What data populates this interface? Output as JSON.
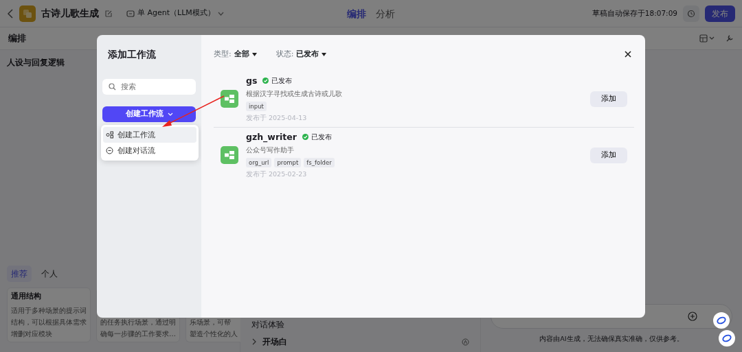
{
  "header": {
    "app_title": "古诗儿歌生成",
    "mode": "单 Agent（LLM模式）",
    "tabs": [
      {
        "label": "编排",
        "selected": true
      },
      {
        "label": "分析",
        "selected": false
      }
    ],
    "save_status": "草稿自动保存于18:07:09",
    "publish": "发布"
  },
  "left_panel": {
    "title": "编排",
    "section": "人设与回复逻辑",
    "template_tabs": [
      {
        "label": "推荐",
        "selected": true
      },
      {
        "label": "个人",
        "selected": false
      }
    ],
    "templates": [
      {
        "title": "通用结构",
        "lines": [
          "适用于多种场景的提示词",
          "结构，可以根据具体需求",
          "增删对应模块"
        ]
      },
      {
        "lines": [
          "的任务执行场景，通过明",
          "确每一步骤的工作要求…"
        ]
      },
      {
        "lines": [
          "乐场景，可帮",
          "塑造个性化的人"
        ]
      }
    ]
  },
  "middle_panel": {
    "section": "对话体验",
    "items": [
      {
        "label": "开场白",
        "expanded": false
      }
    ]
  },
  "chat": {
    "disclaimer": "内容由AI生成，无法确保真实准确，仅供参考。"
  },
  "dialog": {
    "title": "添加工作流",
    "search": {
      "placeholder": "搜索"
    },
    "create_button": "创建工作流",
    "create_menu": [
      {
        "label": "创建工作流",
        "kind": "workflow",
        "highlighted": true
      },
      {
        "label": "创建对话流",
        "kind": "chat",
        "highlighted": false
      }
    ],
    "filters": [
      {
        "label": "类型:",
        "value": "全部"
      },
      {
        "label": "状态:",
        "value": "已发布"
      }
    ],
    "workflows": [
      {
        "name": "gs",
        "status": "已发布",
        "description": "根据汉字寻找或生成古诗或儿歌",
        "params": [
          "input"
        ],
        "published": "发布于 2025-04-13",
        "action": "添加"
      },
      {
        "name": "gzh_writer",
        "status": "已发布",
        "description": "公众号写作助手",
        "params": [
          "org_url",
          "prompt",
          "fs_folder"
        ],
        "published": "发布于 2025-02-23",
        "action": "添加"
      }
    ]
  }
}
